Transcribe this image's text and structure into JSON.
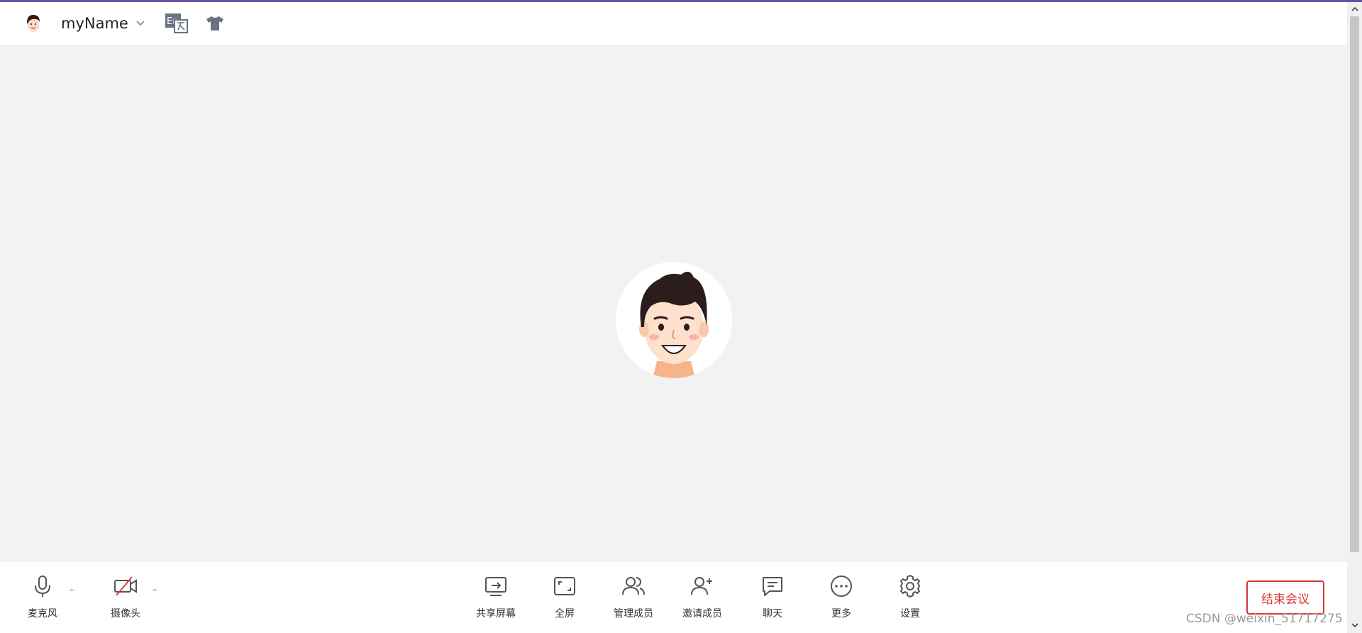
{
  "header": {
    "username": "myName"
  },
  "toolbar": {
    "left": [
      {
        "label": "麦克风",
        "icon": "microphone-icon"
      },
      {
        "label": "摄像头",
        "icon": "camera-off-icon"
      }
    ],
    "center": [
      {
        "label": "共享屏幕",
        "icon": "share-screen-icon"
      },
      {
        "label": "全屏",
        "icon": "fullscreen-icon"
      },
      {
        "label": "管理成员",
        "icon": "members-icon"
      },
      {
        "label": "邀请成员",
        "icon": "invite-member-icon"
      },
      {
        "label": "聊天",
        "icon": "chat-icon"
      },
      {
        "label": "更多",
        "icon": "more-icon"
      },
      {
        "label": "设置",
        "icon": "settings-icon"
      }
    ],
    "end_label": "结束会议"
  },
  "watermark": "CSDN @weixin_51717275",
  "colors": {
    "accent_top": "#6d4fa8",
    "end_button": "#d93636",
    "stage_bg": "#f2f2f2",
    "icon_gray": "#555555"
  }
}
